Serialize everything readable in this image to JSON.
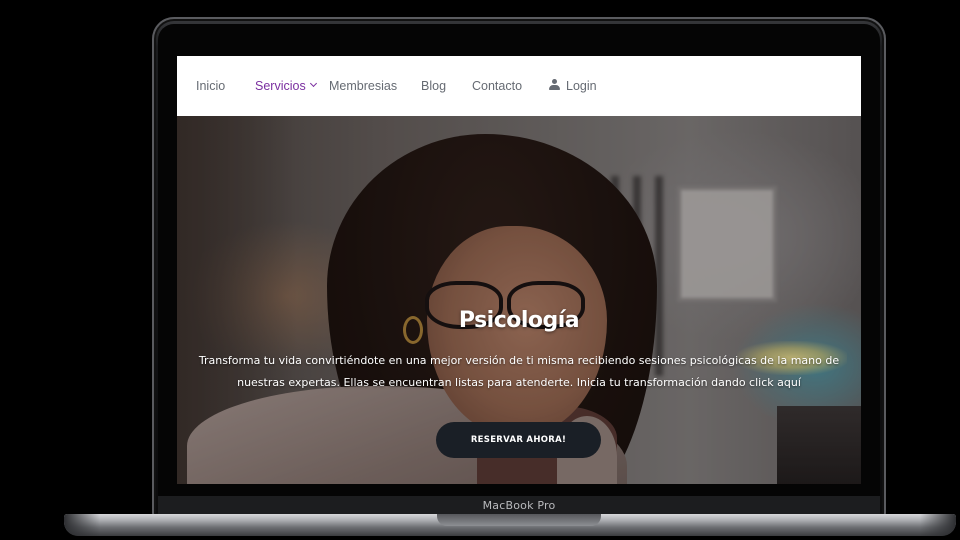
{
  "device": {
    "label": "MacBook Pro"
  },
  "nav": {
    "items": [
      {
        "label": "Inicio",
        "active": false
      },
      {
        "label": "Servicios",
        "active": true,
        "has_dropdown": true
      },
      {
        "label": "Membresias",
        "active": false
      },
      {
        "label": "Blog",
        "active": false
      },
      {
        "label": "Contacto",
        "active": false
      }
    ],
    "login_label": "Login",
    "login_icon": "user-icon"
  },
  "hero": {
    "title": "Psicología",
    "text_line1": "Transforma tu vida convirtiéndote en una mejor versión de ti misma recibiendo sesiones psicológicas de la mano de",
    "text_line2": "nuestras expertas. Ellas se encuentran listas para atenderte. Inicia tu transformación dando click aquí",
    "button_label": "RESERVAR AHORA!"
  },
  "colors": {
    "accent": "#7b2fa0",
    "nav_text": "#666b73",
    "button_bg": "#1a1f26"
  }
}
